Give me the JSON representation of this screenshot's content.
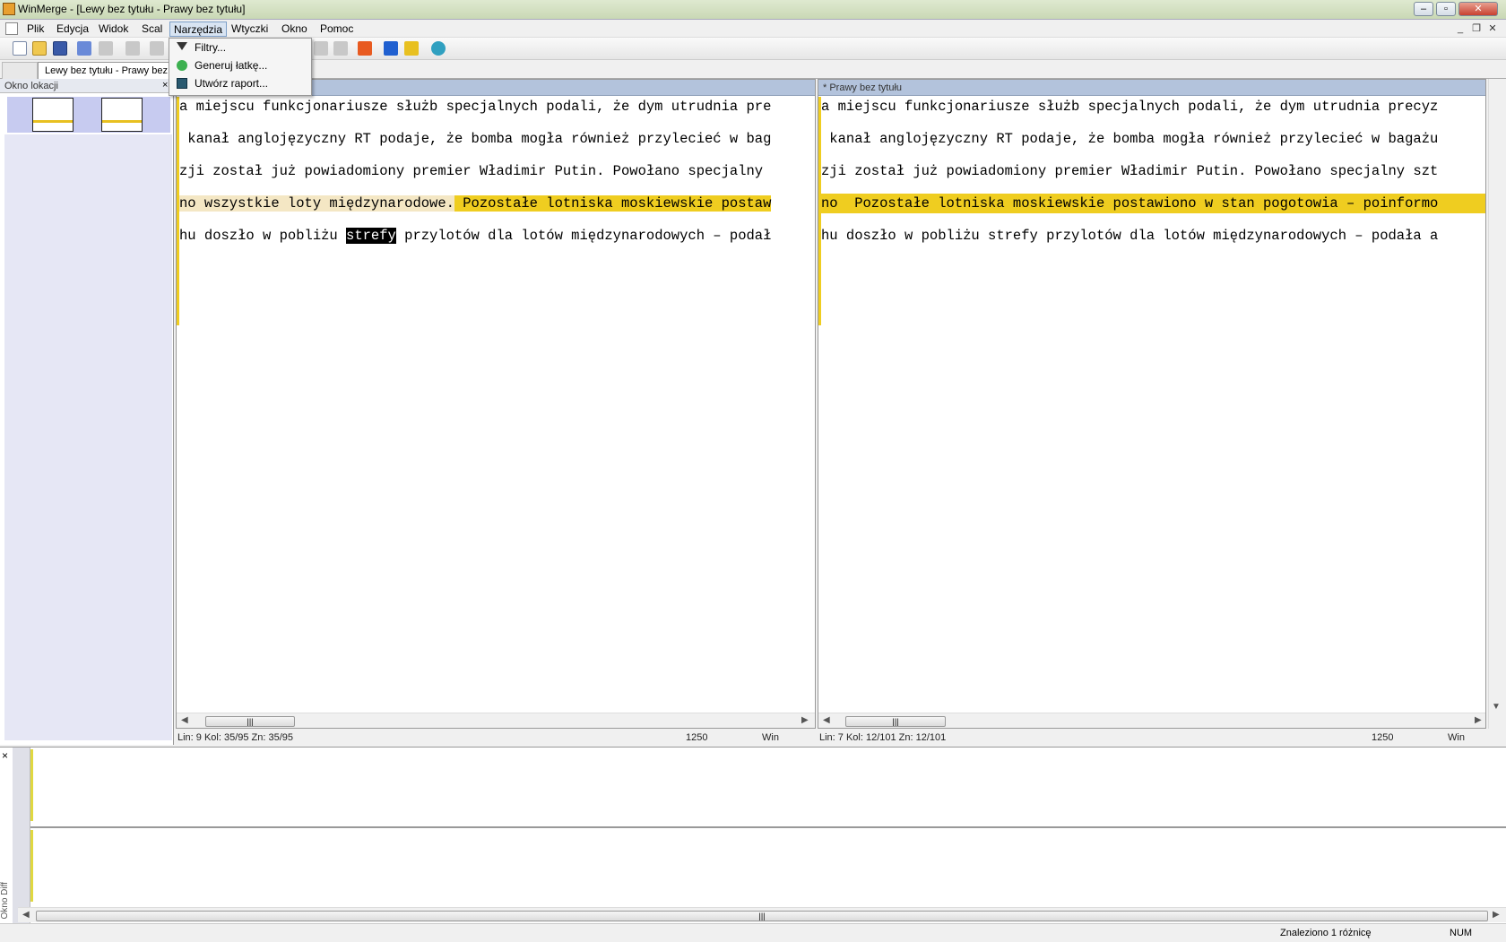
{
  "window": {
    "title": "WinMerge - [Lewy bez tytułu - Prawy bez tytułu]"
  },
  "menubar": {
    "items": [
      {
        "label": "Plik"
      },
      {
        "label": "Edycja"
      },
      {
        "label": "Widok"
      },
      {
        "label": "Scal"
      },
      {
        "label": "Narzędzia"
      },
      {
        "label": "Wtyczki"
      },
      {
        "label": "Okno"
      },
      {
        "label": "Pomoc"
      }
    ]
  },
  "tools_menu": {
    "items": [
      {
        "label": "Filtry..."
      },
      {
        "label": "Generuj łatkę..."
      },
      {
        "label": "Utwórz raport..."
      }
    ]
  },
  "tab": {
    "label": "Lewy bez tytułu - Prawy bez tytułu"
  },
  "location_pane": {
    "title": "Okno lokacji",
    "close": "×"
  },
  "left_pane": {
    "lines": [
      "a miejscu funkcjonariusze służb specjalnych podali, że dym utrudnia pre",
      " kanał anglojęzyczny RT podaje, że bomba mogła również przylecieć w bag",
      "zji został już powiadomiony premier Władimir Putin. Powołano specjalny ",
      "no wszystkie loty międzynarodowe. Pozostałe lotniska moskiewskie postaw",
      "hu doszło w pobliżu strefy przylotów dla lotów międzynarodowych – podał"
    ],
    "line4_parts": {
      "a": "no ",
      "b": "wszystkie loty międzynarodowe.",
      "c": " Pozostałe lotniska moskiewskie postaw"
    },
    "line5_parts": {
      "a": "hu doszło w pobliżu ",
      "sel": "strefy",
      "c": " przylotów dla lotów międzynarodowych – podał"
    },
    "status": {
      "position": "Lin: 9  Kol: 35/95  Zn: 35/95",
      "codepage": "1250",
      "eol": "Win"
    }
  },
  "right_pane": {
    "title": "* Prawy bez tytułu",
    "lines": [
      "a miejscu funkcjonariusze służb specjalnych podali, że dym utrudnia precyz",
      " kanał anglojęzyczny RT podaje, że bomba mogła również przylecieć w bagażu",
      "zji został już powiadomiony premier Władimir Putin. Powołano specjalny szt",
      "no  Pozostałe lotniska moskiewskie postawiono w stan pogotowia – poinformo",
      "hu doszło w pobliżu strefy przylotów dla lotów międzynarodowych – podała a"
    ],
    "status": {
      "position": "Lin: 7  Kol: 12/101  Zn: 12/101",
      "codepage": "1250",
      "eol": "Win"
    }
  },
  "diff_pane": {
    "label": "Okno Diff",
    "close": "×"
  },
  "statusbar": {
    "message": "Znaleziono 1 różnicę",
    "num": "NUM"
  },
  "scroll": {
    "grip": "|||"
  },
  "colors": {
    "diff_highlight": "#efcd20",
    "diff_light": "#f4e7c4",
    "pane_header": "#b3c3dc"
  }
}
